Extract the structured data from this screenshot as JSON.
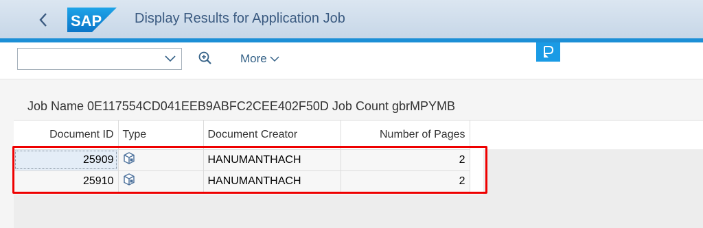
{
  "header": {
    "logo_text": "SAP",
    "title": "Display Results for Application Job",
    "back_icon": "chevron-left-icon"
  },
  "toolbar": {
    "combo_value": "",
    "more_label": "More",
    "zoom_icon": "zoom-in-icon",
    "p_icon": "p-icon"
  },
  "job": {
    "line": "Job Name 0E117554CD041EEB9ABFC2CEE402F50D Job Count gbrMPYMB"
  },
  "table": {
    "columns": [
      "Document ID",
      "Type",
      "Document Creator",
      "Number of Pages"
    ],
    "rows": [
      {
        "doc_id": "25909",
        "type_icon": "document-type-icon",
        "creator": "HANUMANTHACH",
        "pages": "2"
      },
      {
        "doc_id": "25910",
        "type_icon": "document-type-icon",
        "creator": "HANUMANTHACH",
        "pages": "2"
      }
    ]
  },
  "colors": {
    "accent": "#1c8fd6",
    "highlight": "#ee0000",
    "title": "#3a5a80"
  }
}
